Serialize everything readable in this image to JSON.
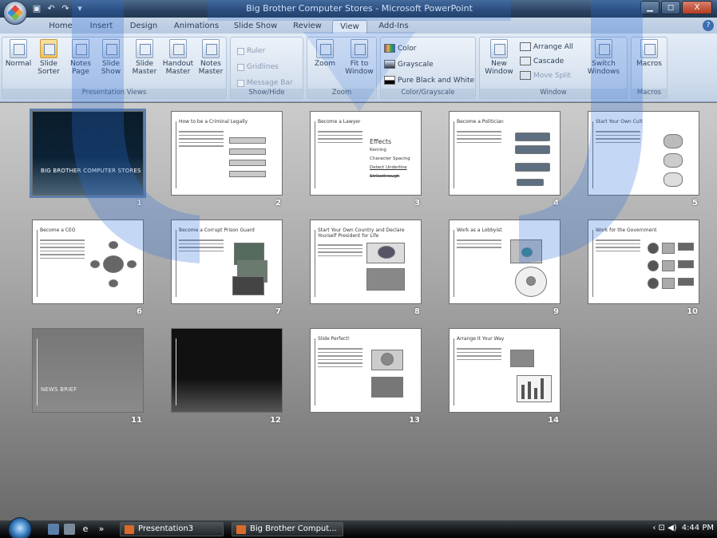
{
  "window": {
    "title": "Big Brother Computer Stores - Microsoft PowerPoint",
    "controls": [
      "▁",
      "◻",
      "X"
    ]
  },
  "qat": {
    "icons": [
      "save-icon",
      "undo-icon",
      "redo-icon",
      "customize-icon"
    ],
    "glyphs": [
      "▣",
      "↶",
      "↷",
      "▾"
    ]
  },
  "ribbon": {
    "tabs": [
      "Home",
      "Insert",
      "Design",
      "Animations",
      "Slide Show",
      "Review",
      "View",
      "Add-Ins"
    ],
    "active_tab": "View",
    "groups": {
      "presentation_views": {
        "label": "Presentation Views",
        "buttons": [
          "Normal",
          "Slide Sorter",
          "Notes Page",
          "Slide Show",
          "Slide Master",
          "Handout Master",
          "Notes Master"
        ]
      },
      "show_hide": {
        "label": "Show/Hide",
        "checks": [
          "Ruler",
          "Gridlines",
          "Message Bar"
        ]
      },
      "zoom": {
        "label": "Zoom",
        "buttons": [
          "Zoom",
          "Fit to Window"
        ]
      },
      "color": {
        "label": "Color/Grayscale",
        "items": [
          "Color",
          "Grayscale",
          "Pure Black and White"
        ]
      },
      "window": {
        "label": "Window",
        "buttons": [
          "New Window"
        ],
        "items": [
          "Arrange All",
          "Cascade",
          "Move Split"
        ],
        "switch": "Switch Windows"
      },
      "macros": {
        "label": "Macros",
        "buttons": [
          "Macros"
        ]
      }
    }
  },
  "slides": [
    {
      "num": "1",
      "title": "BIG BROTHER COMPUTER STORES",
      "subtitle": "",
      "style": "dark"
    },
    {
      "num": "2",
      "title": "How to be a Criminal Legally",
      "style": "light"
    },
    {
      "num": "3",
      "title": "Become a Lawyer",
      "style": "light",
      "extra": [
        "Effects",
        "Kerning",
        "Character Spacing",
        "Detect Underline",
        "Strikethrough"
      ]
    },
    {
      "num": "4",
      "title": "Become a Politician",
      "style": "light"
    },
    {
      "num": "5",
      "title": "Start Your Own Cult",
      "style": "light"
    },
    {
      "num": "6",
      "title": "Become a CEO",
      "style": "light"
    },
    {
      "num": "7",
      "title": "Become a Corrupt Prison Guard",
      "style": "light"
    },
    {
      "num": "8",
      "title": "Start Your Own Country and Declare Yourself President for Life",
      "style": "light"
    },
    {
      "num": "9",
      "title": "Work as a Lobbyist",
      "style": "light"
    },
    {
      "num": "10",
      "title": "Work for the Government",
      "style": "light"
    },
    {
      "num": "11",
      "title": "NEWS BRIEF",
      "style": "gray"
    },
    {
      "num": "12",
      "title": "",
      "style": "black"
    },
    {
      "num": "13",
      "title": "Slide Perfect!",
      "style": "light"
    },
    {
      "num": "14",
      "title": "Arrange It Your Way",
      "style": "light"
    }
  ],
  "taskbar": {
    "tasks": [
      "Presentation3",
      "Big Brother Comput..."
    ],
    "time": "4:44 PM",
    "tray": "‹  ⊡ ◀)"
  },
  "colors": {
    "watermark_blue": "#2a6fdc",
    "ribbon": "#cfdcec",
    "sorter_bg": "#a9a9a9"
  }
}
